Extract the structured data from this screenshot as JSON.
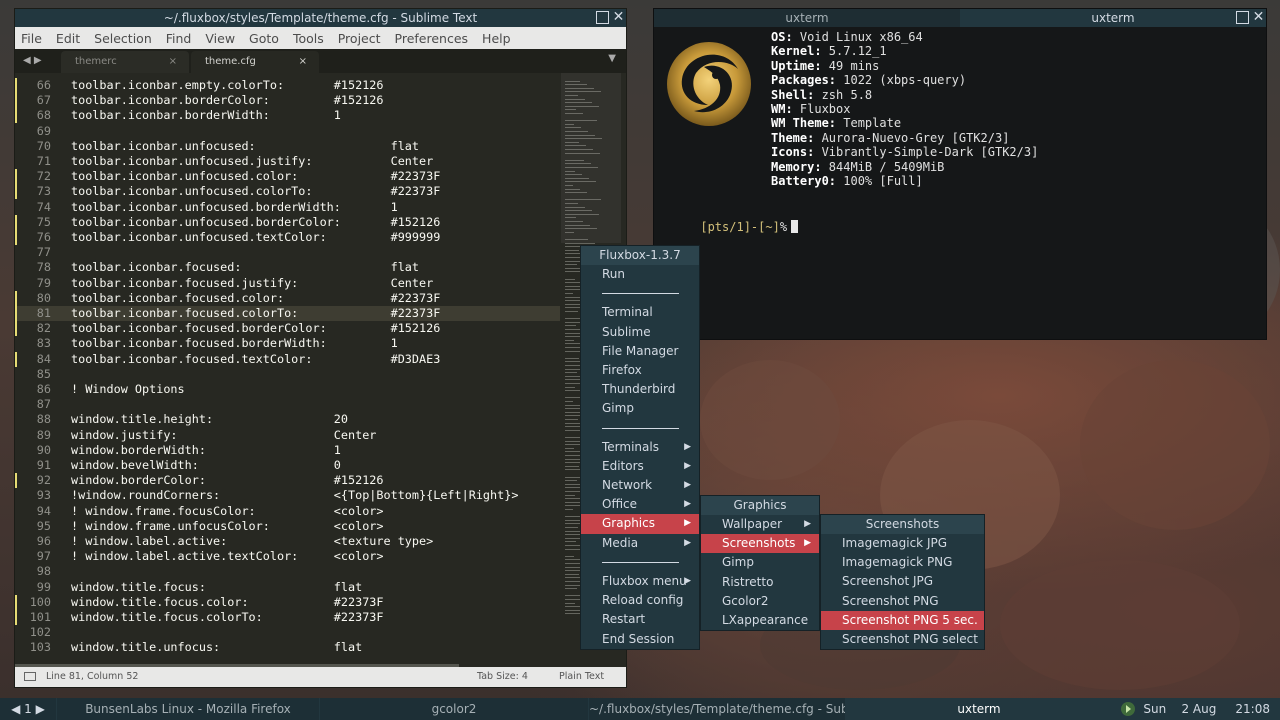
{
  "sublime": {
    "title": "~/.fluxbox/styles/Template/theme.cfg - Sublime Text",
    "menu": [
      "File",
      "Edit",
      "Selection",
      "Find",
      "View",
      "Goto",
      "Tools",
      "Project",
      "Preferences",
      "Help"
    ],
    "tabs": [
      {
        "label": "themerc",
        "close": "×"
      },
      {
        "label": "theme.cfg",
        "close": "×"
      }
    ],
    "nav_arrows": "◀ ▶",
    "dropdown": "▼",
    "lines": [
      {
        "n": "66",
        "code": "toolbar.iconbar.empty.colorTo:       #152126",
        "mark": true
      },
      {
        "n": "67",
        "code": "toolbar.iconbar.borderColor:         #152126",
        "mark": true
      },
      {
        "n": "68",
        "code": "toolbar.iconbar.borderWidth:         1",
        "mark": true
      },
      {
        "n": "69",
        "code": "",
        "mark": false
      },
      {
        "n": "70",
        "code": "toolbar.iconbar.unfocused:                   flat",
        "mark": false
      },
      {
        "n": "71",
        "code": "toolbar.iconbar.unfocused.justify:           Center",
        "mark": false
      },
      {
        "n": "72",
        "code": "toolbar.iconbar.unfocused.color:             #22373F",
        "mark": true
      },
      {
        "n": "73",
        "code": "toolbar.iconbar.unfocused.colorTo:           #22373F",
        "mark": true
      },
      {
        "n": "74",
        "code": "toolbar.iconbar.unfocused.borderWidth:       1",
        "mark": false
      },
      {
        "n": "75",
        "code": "toolbar.iconbar.unfocused.borderColor:       #152126",
        "mark": true
      },
      {
        "n": "76",
        "code": "toolbar.iconbar.unfocused.textColor:         #999999",
        "mark": true
      },
      {
        "n": "77",
        "code": "",
        "mark": false
      },
      {
        "n": "78",
        "code": "toolbar.iconbar.focused:                     flat",
        "mark": false
      },
      {
        "n": "79",
        "code": "toolbar.iconbar.focused.justify:             Center",
        "mark": false
      },
      {
        "n": "80",
        "code": "toolbar.iconbar.focused.color:               #22373F",
        "mark": true
      },
      {
        "n": "81",
        "code": "toolbar.iconbar.focused.colorTo:             #22373F",
        "mark": true,
        "current": true
      },
      {
        "n": "82",
        "code": "toolbar.iconbar.focused.borderColor:         #152126",
        "mark": true
      },
      {
        "n": "83",
        "code": "toolbar.iconbar.focused.borderWidth:         1",
        "mark": false
      },
      {
        "n": "84",
        "code": "toolbar.iconbar.focused.textColor:           #D3DAE3",
        "mark": true
      },
      {
        "n": "85",
        "code": "",
        "mark": false
      },
      {
        "n": "86",
        "code": "! Window Options",
        "mark": false
      },
      {
        "n": "87",
        "code": "",
        "mark": false
      },
      {
        "n": "88",
        "code": "window.title.height:                 20",
        "mark": false
      },
      {
        "n": "89",
        "code": "window.justify:                      Center",
        "mark": false
      },
      {
        "n": "90",
        "code": "window.borderWidth:                  1",
        "mark": false
      },
      {
        "n": "91",
        "code": "window.bevelWidth:                   0",
        "mark": false
      },
      {
        "n": "92",
        "code": "window.borderColor:                  #152126",
        "mark": true
      },
      {
        "n": "93",
        "code": "!window.roundCorners:                <{Top|Bottom}{Left|Right}>",
        "mark": false
      },
      {
        "n": "94",
        "code": "! window.frame.focusColor:           <color>",
        "mark": false
      },
      {
        "n": "95",
        "code": "! window.frame.unfocusColor:         <color>",
        "mark": false
      },
      {
        "n": "96",
        "code": "! window.label.active:               <texture type>",
        "mark": false
      },
      {
        "n": "97",
        "code": "! window.label.active.textColor:     <color>",
        "mark": false
      },
      {
        "n": "98",
        "code": "",
        "mark": false
      },
      {
        "n": "99",
        "code": "window.title.focus:                  flat",
        "mark": false
      },
      {
        "n": "100",
        "code": "window.title.focus.color:            #22373F",
        "mark": true
      },
      {
        "n": "101",
        "code": "window.title.focus.colorTo:          #22373F",
        "mark": true
      },
      {
        "n": "102",
        "code": "",
        "mark": false
      },
      {
        "n": "103",
        "code": "window.title.unfocus:                flat",
        "mark": false
      }
    ],
    "status": {
      "position": "Line 81, Column 52",
      "tabsize": "Tab Size: 4",
      "syntax": "Plain Text"
    }
  },
  "uxterm": {
    "tabs": [
      "uxterm",
      "uxterm"
    ],
    "info": [
      {
        "k": "OS:",
        "v": " Void Linux x86_64"
      },
      {
        "k": "Kernel:",
        "v": " 5.7.12_1"
      },
      {
        "k": "Uptime:",
        "v": " 49 mins"
      },
      {
        "k": "Packages:",
        "v": " 1022 (xbps-query)"
      },
      {
        "k": "Shell:",
        "v": " zsh 5.8"
      },
      {
        "k": "WM:",
        "v": " Fluxbox"
      },
      {
        "k": "WM Theme:",
        "v": " Template"
      },
      {
        "k": "Theme:",
        "v": " Aurora-Nuevo-Grey [GTK2/3]"
      },
      {
        "k": "Icons:",
        "v": " Vibrantly-Simple-Dark [GTK2/3]"
      },
      {
        "k": "Memory:",
        "v": " 844MiB / 5409MiB"
      },
      {
        "k": "Battery0:",
        "v": " 100% [Full]"
      }
    ],
    "prompt": "[pts/1]-[~]",
    "prompt_symbol": "%"
  },
  "root_menu": {
    "title": "Fluxbox-1.3.7",
    "items": [
      {
        "label": "Run"
      },
      {
        "sep": true
      },
      {
        "label": "Terminal"
      },
      {
        "label": "Sublime"
      },
      {
        "label": "File Manager"
      },
      {
        "label": "Firefox"
      },
      {
        "label": "Thunderbird"
      },
      {
        "label": "Gimp"
      },
      {
        "sep": true
      },
      {
        "label": "Terminals",
        "sub": true
      },
      {
        "label": "Editors",
        "sub": true
      },
      {
        "label": "Network",
        "sub": true
      },
      {
        "label": "Office",
        "sub": true
      },
      {
        "label": "Graphics",
        "sub": true,
        "hl": true
      },
      {
        "label": "Media",
        "sub": true
      },
      {
        "sep": true
      },
      {
        "label": "Fluxbox menu",
        "sub": true
      },
      {
        "label": "Reload config"
      },
      {
        "label": "Restart"
      },
      {
        "label": "End Session"
      }
    ]
  },
  "graphics_menu": {
    "title": "Graphics",
    "items": [
      {
        "label": "Wallpaper",
        "sub": true
      },
      {
        "label": "Screenshots",
        "sub": true,
        "hl": true
      },
      {
        "label": "Gimp"
      },
      {
        "label": "Ristretto"
      },
      {
        "label": "Gcolor2"
      },
      {
        "label": "LXappearance"
      }
    ]
  },
  "screenshots_menu": {
    "title": "Screenshots",
    "items": [
      {
        "label": "Imagemagick JPG"
      },
      {
        "label": "Imagemagick PNG"
      },
      {
        "label": "Screenshot JPG"
      },
      {
        "label": "Screenshot PNG"
      },
      {
        "label": "Screenshot PNG 5 sec.",
        "hl": true
      },
      {
        "label": "Screenshot PNG select"
      }
    ]
  },
  "taskbar": {
    "workspace": "◀ 1 ▶",
    "items": [
      {
        "label": "BunsenLabs Linux - Mozilla Firefox",
        "active": false
      },
      {
        "label": "gcolor2",
        "active": false
      },
      {
        "label": "~/.fluxbox/styles/Template/theme.cfg - Subli",
        "active": false
      },
      {
        "label": "uxterm",
        "active": true
      }
    ],
    "day": "Sun",
    "date": "2 Aug",
    "time": "21:08"
  },
  "colors": {
    "menu_bg": "#22373F",
    "menu_highlight": "#C7434A",
    "border": "#152126",
    "text": "#D3DAE3",
    "gutter_mark": "#E6DB74"
  }
}
